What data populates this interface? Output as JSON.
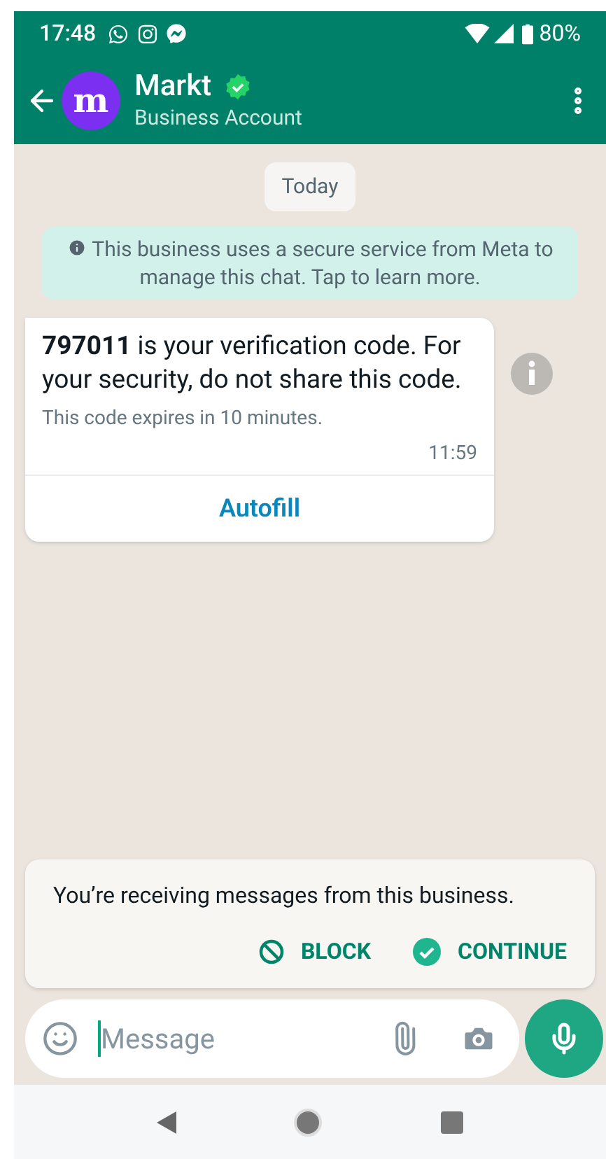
{
  "status_bar": {
    "time": "17:48",
    "battery": "80%"
  },
  "header": {
    "avatar_letter": "m",
    "name": "Markt",
    "subtitle": "Business Account"
  },
  "chat": {
    "date": "Today",
    "notice": "This business uses a secure service from Meta to manage this chat. Tap to learn more.",
    "message": {
      "text": "**797011** is your verification code. For your security, do not share this code.",
      "note": "This code expires in 10 minutes.",
      "time": "11:59",
      "action": "Autofill"
    }
  },
  "business_card": {
    "text": "You’re receiving messages from this business.",
    "buttons": [
      {
        "kind": "block",
        "label": "BLOCK"
      },
      {
        "kind": "continue",
        "label": "CONTINUE"
      }
    ]
  },
  "composer": {
    "placeholder": "Message"
  }
}
